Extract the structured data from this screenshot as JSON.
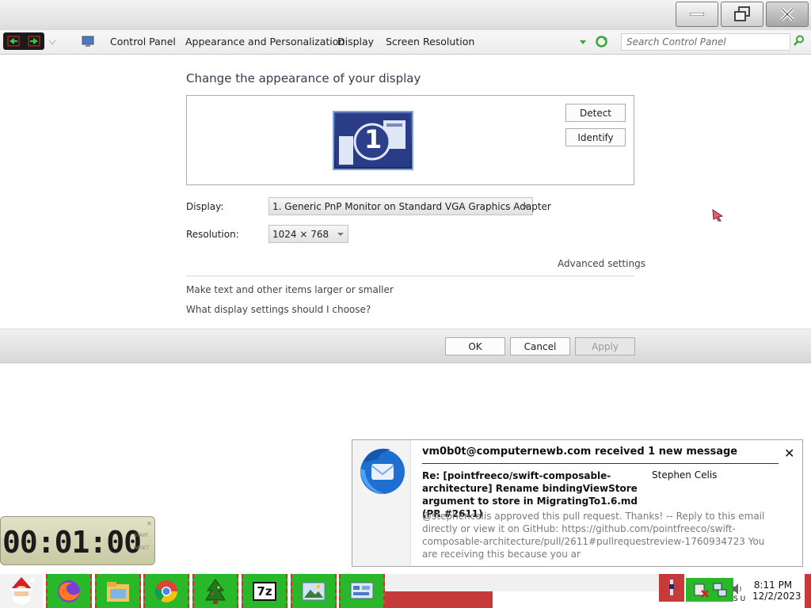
{
  "window": {
    "buttons": [
      "minimize",
      "maximize",
      "close"
    ]
  },
  "addressbar": {
    "breadcrumbs": [
      "Control Panel",
      "Appearance and Personalization",
      "Display",
      "Screen Resolution"
    ],
    "search_placeholder": "Search Control Panel"
  },
  "main": {
    "heading": "Change the appearance of your display",
    "monitor_number": "1",
    "detect_label": "Detect",
    "identify_label": "Identify",
    "display_label": "Display:",
    "display_value": "1. Generic PnP Monitor on Standard VGA Graphics Adapter",
    "resolution_label": "Resolution:",
    "resolution_value": "1024 × 768",
    "advanced_link": "Advanced settings",
    "link_text_size": "Make text and other items larger or smaller",
    "link_which_settings": "What display settings should I choose?"
  },
  "buttons": {
    "ok": "OK",
    "cancel": "Cancel",
    "apply": "Apply"
  },
  "notification": {
    "title": "vm0b0t@computernewb.com received 1 new message",
    "subject": "Re: [pointfreeco/swift-composable-architecture] Rename bindingViewStore argument to store in MigratingTo1.6.md (PR #2611)",
    "sender": "Stephen Celis",
    "preview": "@stephencelis approved this pull request. Thanks! -- Reply to this email directly or view it on GitHub: https://github.com/pointfreeco/swift-composable-architecture/pull/2611#pullrequestreview-1760934723 You are receiving this because you ar"
  },
  "clock_widget": {
    "time": "00:01:00",
    "start_label": "START",
    "reset_label": "RESET"
  },
  "taskbar": {
    "time": "8:11 PM",
    "date": "12/2/2023",
    "seven_zip_label": "7z",
    "tray_text": "S U"
  },
  "colors": {
    "taskbar_item_green": "#29b829",
    "taskbar_item_border": "#d62c2c",
    "monitor_blue": "#2a3c86"
  }
}
